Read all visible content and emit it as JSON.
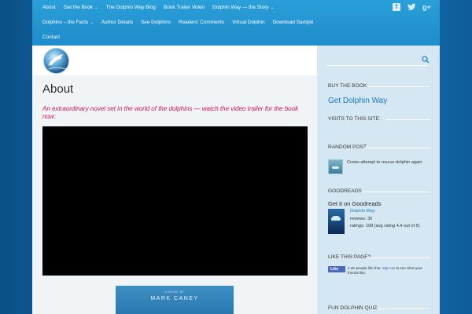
{
  "nav": {
    "row1": [
      "About",
      "Get the Book",
      "The Dolphin Way Blog",
      "Book Trailer Video",
      "Dolphin Way — the Story"
    ],
    "row1_caret": [
      false,
      true,
      false,
      false,
      true
    ],
    "row2": [
      "Dolphins – the Facts",
      "Author Details",
      "See Dolphins",
      "Readers' Comments",
      "Virtual Dolphin",
      "Download Sample"
    ],
    "row2_caret": [
      true,
      false,
      false,
      false,
      false,
      false
    ],
    "row3": [
      "Contact"
    ],
    "caret_symbol": "⌄"
  },
  "social": {
    "icons": [
      "facebook-icon",
      "twitter-icon",
      "google-plus-icon"
    ],
    "glyphs": [
      "f",
      "t",
      "g+"
    ]
  },
  "search": {
    "placeholder": "",
    "value": ""
  },
  "main": {
    "title": "About",
    "intro": "An extraordinary novel set in the world of the dolphins — watch the video trailer for the book now:",
    "cover_subtitle": "A NOVEL BY",
    "cover_author": "MARK CANEY"
  },
  "sidebar": {
    "buy_title": "BUY THE BOOK",
    "buy_link": "Get Dolphin Way",
    "visits_title": "VISITS TO THIS SITE:",
    "random_title": "RANDOM POST",
    "random_post": "Crews attempt to rescue dolphin again",
    "goodreads_title": "GOODREADS",
    "goodreads_link": "Get it on Goodreads",
    "gr_book": "Dolphin Way",
    "gr_reviews": "reviews: 30",
    "gr_ratings": "ratings: 108 (avg rating 4.4 out of 5)",
    "like_title": "LIKE THIS PAGE?",
    "like_button": "Like",
    "like_count_text": "1.2K people like this.",
    "like_signup": "Sign Up",
    "like_rest": "to see what your friends like.",
    "quiz_title": "FUN DOLPHIN QUIZ"
  },
  "colors": {
    "nav_bg": "#1f8ccb",
    "link_blue": "#1a78c2",
    "intro_magenta": "#c8105a",
    "sidebar_bg": "#d4e7f2"
  }
}
